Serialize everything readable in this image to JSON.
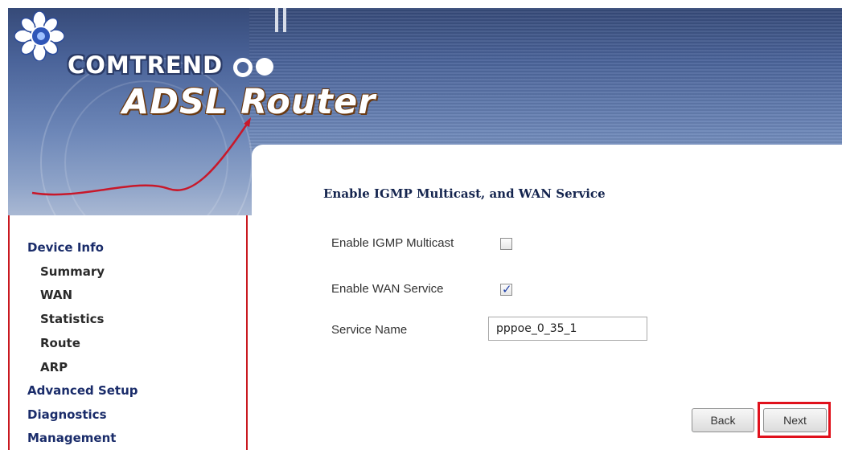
{
  "header": {
    "brand": "COMTREND",
    "product": "ADSL Router",
    "logo_icon": "comtrend-flower-icon"
  },
  "sidebar": {
    "items": [
      {
        "label": "Device Info",
        "level": 0
      },
      {
        "label": "Summary",
        "level": 1
      },
      {
        "label": "WAN",
        "level": 1
      },
      {
        "label": "Statistics",
        "level": 1
      },
      {
        "label": "Route",
        "level": 1
      },
      {
        "label": "ARP",
        "level": 1
      },
      {
        "label": "Advanced Setup",
        "level": 0
      },
      {
        "label": "Diagnostics",
        "level": 0
      },
      {
        "label": "Management",
        "level": 0
      }
    ]
  },
  "main": {
    "title": "Enable IGMP Multicast, and WAN Service",
    "igmp": {
      "label": "Enable IGMP Multicast",
      "checked": false
    },
    "wan_service": {
      "label": "Enable WAN Service",
      "checked": true
    },
    "service_name": {
      "label": "Service Name",
      "value": "pppoe_0_35_1"
    },
    "buttons": {
      "back": "Back",
      "next": "Next"
    }
  },
  "colors": {
    "nav_text": "#1a2c6a",
    "sidebar_border": "#c9181f",
    "highlight": "#e0111c",
    "banner": "#4a6399"
  }
}
